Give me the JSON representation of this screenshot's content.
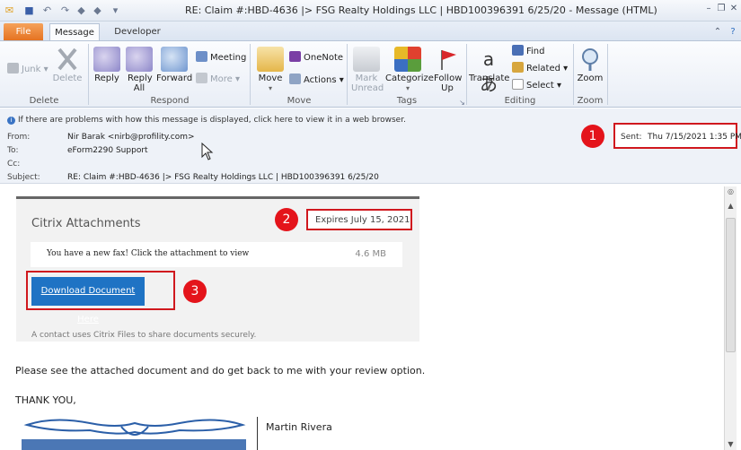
{
  "window": {
    "title": "RE: Claim #:HBD-4636 |> FSG Realty Holdings LLC | HBD100396391 6/25/20 - Message (HTML)",
    "controls": [
      "minimize",
      "restore",
      "close"
    ]
  },
  "tabs": [
    "File",
    "Message",
    "Developer"
  ],
  "ribbon": {
    "groups": {
      "delete": "Delete",
      "respond": "Respond",
      "move": "Move",
      "tags": "Tags",
      "editing": "Editing",
      "zoom": "Zoom"
    },
    "junk": "Junk",
    "delete_btn": "Delete",
    "reply": "Reply",
    "reply_all": "Reply All",
    "forward": "Forward",
    "meeting": "Meeting",
    "more": "More",
    "move_btn": "Move",
    "onenote": "OneNote",
    "actions": "Actions",
    "mark_unread": "Mark Unread",
    "categorize": "Categorize",
    "follow_up": "Follow Up",
    "translate": "Translate",
    "find": "Find",
    "related": "Related",
    "select": "Select",
    "zoom_btn": "Zoom"
  },
  "header": {
    "infobar": "If there are problems with how this message is displayed, click here to view it in a web browser.",
    "from_label": "From:",
    "from": "Nir Barak <nirb@profility.com>",
    "to_label": "To:",
    "to": "eForm2290 Support",
    "cc_label": "Cc:",
    "cc": "",
    "subject_label": "Subject:",
    "subject": "RE: Claim #:HBD-4636 |> FSG Realty Holdings LLC | HBD100396391 6/25/20",
    "sent_label": "Sent:",
    "sent": "Thu 7/15/2021 1:35 PM"
  },
  "callouts": [
    "1",
    "2",
    "3"
  ],
  "citrix": {
    "title": "Citrix Attachments",
    "expires": "Expires July 15, 2021",
    "fax_text": "You have a new fax! Click the attachment to view",
    "fax_size": "4.6 MB",
    "download": "Download Document Here",
    "footnote": "A contact uses Citrix Files to share documents securely."
  },
  "body": {
    "text": "Please see the attached document and do get back to me with your review option.",
    "thanks": "THANK YOU,",
    "signature_name": "Martin Rivera"
  }
}
